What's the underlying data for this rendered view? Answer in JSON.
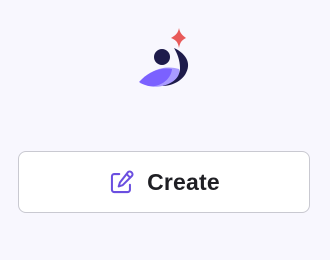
{
  "colors": {
    "background": "#f8f7fe",
    "button_background": "#ffffff",
    "button_border": "#c9c9d1",
    "button_text": "#1f1f24",
    "icon_accent": "#6b4fe0",
    "logo_dark": "#1e1b4b",
    "logo_purple": "#7b61ff",
    "logo_light_purple": "#a99bff",
    "logo_star": "#e85a5a"
  },
  "logo": {
    "icon": "brand-logo-person-sparkle"
  },
  "create_button": {
    "label": "Create",
    "icon": "edit-icon"
  }
}
